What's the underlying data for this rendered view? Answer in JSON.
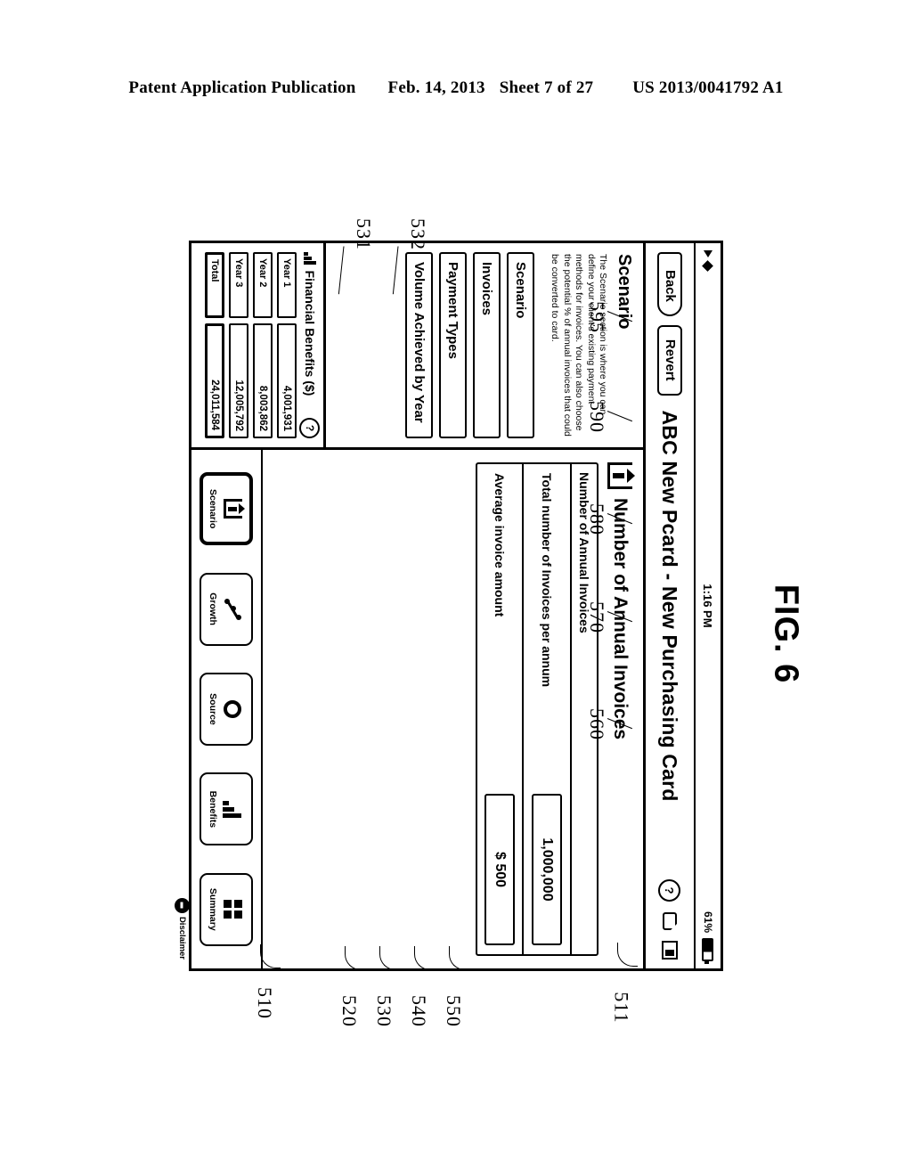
{
  "patent_header": {
    "publication": "Patent Application Publication",
    "date": "Feb. 14, 2013",
    "sheet": "Sheet 7 of 27",
    "number": "US 2013/0041792 A1"
  },
  "figure_label": "FIG. 6",
  "status_bar": {
    "time": "1:16 PM",
    "battery_percent": "61%"
  },
  "nav_bar": {
    "back_label": "Back",
    "revert_label": "Revert",
    "title": "ABC New Pcard - New Purchasing Card",
    "help_glyph": "?"
  },
  "sidebar": {
    "title": "Scenario",
    "description": "The Scenario section is where you can define your client's existing payment methods for invoices. You can also choose the potential % of annual invoices that could be converted to card.",
    "items": [
      {
        "label": "Scenario"
      },
      {
        "label": "Invoices"
      },
      {
        "label": "Payment Types"
      },
      {
        "label": "Volume Achieved by Year"
      }
    ]
  },
  "financial_benefits": {
    "title": "Financial Benefits ($)",
    "help_glyph": "?",
    "rows": [
      {
        "label": "Year 1",
        "value": "4,001,931"
      },
      {
        "label": "Year 2",
        "value": "8,003,862"
      },
      {
        "label": "Year 3",
        "value": "12,005,792"
      },
      {
        "label": "Total",
        "value": "24,011,584"
      }
    ]
  },
  "main": {
    "header_title": "Number of Annual Invoices",
    "card_title": "Number of Annual Invoices",
    "fields": [
      {
        "label": "Total number of Invoices per annum",
        "value": "1,000,000"
      },
      {
        "label": "Average invoice amount",
        "value": "$ 500"
      }
    ]
  },
  "toolbar": {
    "buttons": [
      {
        "label": "Scenario",
        "active": true
      },
      {
        "label": "Growth",
        "active": false
      },
      {
        "label": "Source",
        "active": false
      },
      {
        "label": "Benefits",
        "active": false
      },
      {
        "label": "Summary",
        "active": false
      }
    ],
    "disclaimer_label": "Disclaimer"
  },
  "reference_numerals": {
    "r510": "510",
    "r511": "511",
    "r520": "520",
    "r530": "530",
    "r531": "531",
    "r532": "532",
    "r540": "540",
    "r550": "550",
    "r560": "560",
    "r570": "570",
    "r580": "580",
    "r590": "590",
    "r595": "595"
  }
}
